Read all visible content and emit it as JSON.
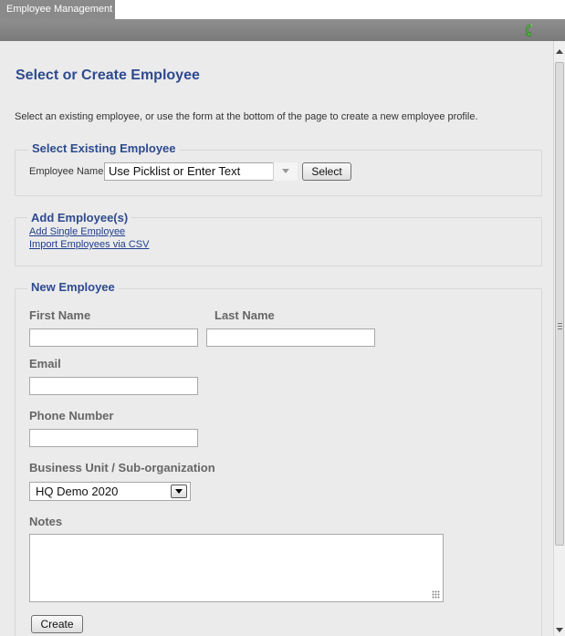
{
  "tabs": [
    {
      "label": "Employee Management"
    }
  ],
  "page": {
    "title": "Select or Create Employee",
    "intro": "Select an existing employee, or use the form at the bottom of the page to create a new employee profile."
  },
  "select_existing": {
    "legend": "Select Existing Employee",
    "name_label": "Employee Name:",
    "picklist_value": "Use Picklist or Enter Text",
    "select_button": "Select"
  },
  "add_employees": {
    "legend": "Add Employee(s)",
    "links": [
      "Add Single Employee",
      "Import Employees via CSV"
    ]
  },
  "new_employee": {
    "legend": "New Employee",
    "first_name_label": "First Name",
    "last_name_label": "Last Name",
    "email_label": "Email",
    "phone_label": "Phone Number",
    "business_unit_label": "Business Unit / Sub-organization",
    "business_unit_value": "HQ Demo 2020",
    "notes_label": "Notes",
    "create_button": "Create"
  },
  "colors": {
    "accent": "#2e4a8e",
    "toolbar": "#7f7f7f",
    "panel": "#ebebeb"
  },
  "icons": {
    "toolbar": "refresh-icon"
  }
}
